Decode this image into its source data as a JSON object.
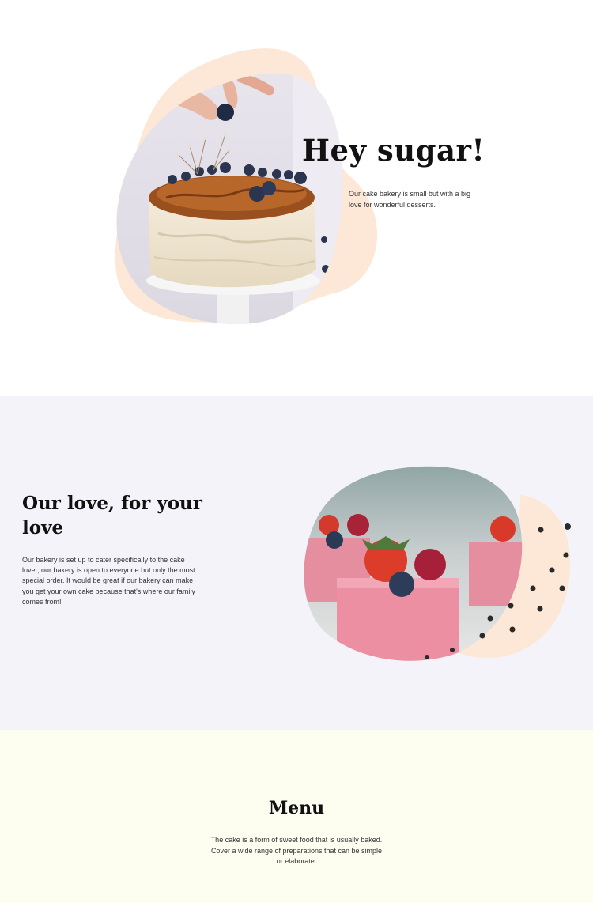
{
  "hero": {
    "title": "Hey sugar!",
    "text": "Our cake bakery is small but with a big love for wonderful desserts."
  },
  "about": {
    "title": "Our love, for your love",
    "text": "Our bakery is set up to cater specifically to the cake lover, our bakery is open to everyone but only the most special order. It would be great if our bakery can make you get your own cake because that's where our family comes from!"
  },
  "menu": {
    "title": "Menu",
    "text": "The cake is a form of sweet food that is usually baked. Cover a wide range of preparations that can be simple or elaborate."
  },
  "colors": {
    "accent_peach": "#fde7d6",
    "section_lavender": "#f4f3fa",
    "section_cream": "#fefef0"
  }
}
